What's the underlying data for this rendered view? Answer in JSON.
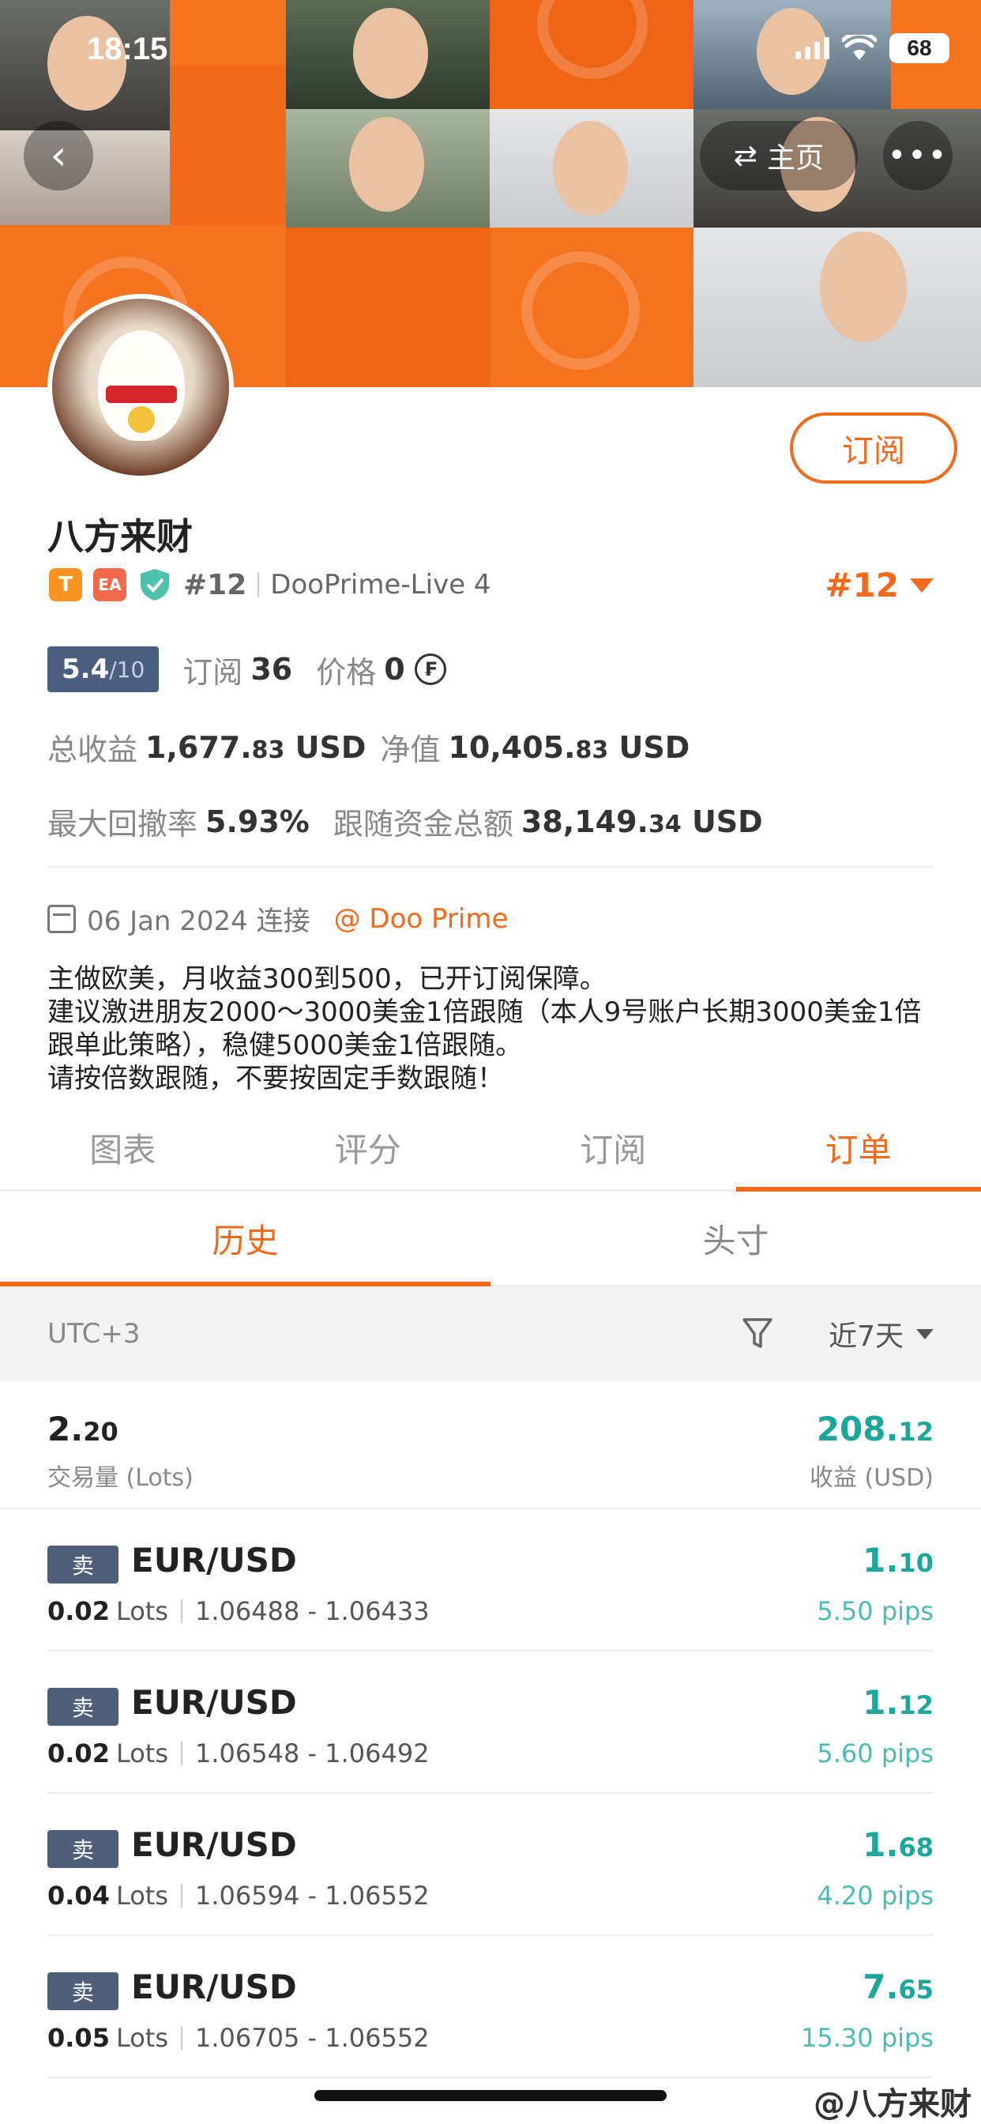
{
  "status_bar": {
    "time": "18:15",
    "battery": "68"
  },
  "header": {
    "home_label": "主页",
    "more_label": "•••"
  },
  "profile": {
    "name": "八方来财",
    "badge_t": "T",
    "badge_ea": "EA",
    "rank": "#12",
    "server": "DooPrime-Live 4",
    "rank_large": "#12",
    "subscribe_label": "订阅"
  },
  "stats": {
    "score": "5.4",
    "score_max": "/10",
    "subs_label": "订阅",
    "subs_value": "36",
    "price_label": "价格",
    "price_value": "0",
    "price_symbol": "₣",
    "total_profit_label": "总收益",
    "total_profit_int": "1,677.",
    "total_profit_dec": "83",
    "total_profit_unit": "USD",
    "equity_label": "净值",
    "equity_int": "10,405.",
    "equity_dec": "83",
    "equity_unit": "USD",
    "drawdown_label": "最大回撤率",
    "drawdown_value": "5.93%",
    "follow_label": "跟随资金总额",
    "follow_int": "38,149.",
    "follow_dec": "34",
    "follow_unit": "USD"
  },
  "connection": {
    "date": "06 Jan 2024 连接",
    "broker": "@ Doo Prime"
  },
  "description": "主做欧美，月收益300到500，已开订阅保障。\n建议激进朋友2000～3000美金1倍跟随（本人9号账户长期3000美金1倍跟单此策略），稳健5000美金1倍跟随。\n请按倍数跟随，不要按固定手数跟随！",
  "tabs": [
    "图表",
    "评分",
    "订阅",
    "订单"
  ],
  "subtabs": [
    "历史",
    "头寸"
  ],
  "filter": {
    "timezone": "UTC+3",
    "period": "近7天"
  },
  "summary": {
    "volume_int": "2.",
    "volume_dec": "20",
    "volume_label": "交易量 (Lots)",
    "profit_int": "208.",
    "profit_dec": "12",
    "profit_label": "收益 (USD)"
  },
  "orders": [
    {
      "side": "卖",
      "symbol": "EUR/USD",
      "lots": "0.02",
      "lots_unit": "Lots",
      "range": "1.06488 - 1.06433",
      "profit_int": "1.",
      "profit_dec": "10",
      "pips": "5.50 pips"
    },
    {
      "side": "卖",
      "symbol": "EUR/USD",
      "lots": "0.02",
      "lots_unit": "Lots",
      "range": "1.06548 - 1.06492",
      "profit_int": "1.",
      "profit_dec": "12",
      "pips": "5.60 pips"
    },
    {
      "side": "卖",
      "symbol": "EUR/USD",
      "lots": "0.04",
      "lots_unit": "Lots",
      "range": "1.06594 - 1.06552",
      "profit_int": "1.",
      "profit_dec": "68",
      "pips": "4.20 pips"
    },
    {
      "side": "卖",
      "symbol": "EUR/USD",
      "lots": "0.05",
      "lots_unit": "Lots",
      "range": "1.06705 - 1.06552",
      "profit_int": "7.",
      "profit_dec": "65",
      "pips": "15.30 pips"
    }
  ],
  "watermark": "@八方来财"
}
